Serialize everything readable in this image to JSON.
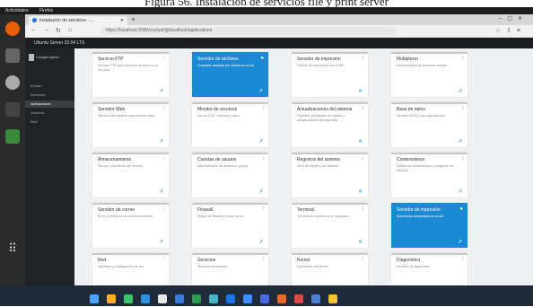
{
  "caption": "Figura 56. Instalación de servicios file y print server",
  "top_bar": {
    "activities": "Actividades",
    "app": "Firefox",
    "clock": "",
    "tray": ""
  },
  "browser": {
    "tab_title": "Instalación de servicios - ...",
    "url": "https://localhost:9090/cockpit/@localhost/applications",
    "url_right": ""
  },
  "cockpit": {
    "host": "Ubuntu Server 22.04 LTS",
    "user": ""
  },
  "sidebar": {
    "header": "Cockpit Admin",
    "items": [
      {
        "label": "Estado"
      },
      {
        "label": "Servicios"
      },
      {
        "label": "Aplicaciones"
      },
      {
        "label": "Archivos"
      },
      {
        "label": "Red"
      }
    ]
  },
  "cards": [
    {
      "title": "Servicio FTP",
      "desc": "Servidor FTP para compartir archivos en la red local",
      "mark": "i",
      "action": "↗",
      "selected": false
    },
    {
      "title": "Servidor de archivos",
      "desc": "Comparte carpetas con Samba en la red",
      "mark": "●",
      "action": "↗",
      "selected": true
    },
    {
      "title": "Servidor de impresión",
      "desc": "Gestión de impresoras con CUPS",
      "mark": "i",
      "action": "✕",
      "selected": false
    },
    {
      "title": "Multiplexor",
      "desc": "Administración de sesiones remotas",
      "mark": "i",
      "action": "↗",
      "selected": false
    },
    {
      "title": "Servidor Web",
      "desc": "Servidor web Apache para publicar sitios",
      "mark": "i",
      "action": "↗",
      "selected": false
    },
    {
      "title": "Monitor de recursos",
      "desc": "Uso de CPU, memoria y disco",
      "mark": "i",
      "action": "↗",
      "selected": false
    },
    {
      "title": "Actualizaciones del sistema",
      "desc": "Paquetes pendientes de instalar y actualizaciones de seguridad",
      "mark": "i",
      "action": "✕",
      "selected": false
    },
    {
      "title": "Base de datos",
      "desc": "Servidor MySQL para aplicaciones",
      "mark": "i",
      "action": "↗",
      "selected": false
    },
    {
      "title": "Almacenamiento",
      "desc": "Discos y volúmenes del servidor",
      "mark": "i",
      "action": "↗",
      "selected": false
    },
    {
      "title": "Cuentas de usuario",
      "desc": "Administración de usuarios y grupos",
      "mark": "i",
      "action": "↗",
      "selected": false
    },
    {
      "title": "Registros del sistema",
      "desc": "Visor de registros del sistema",
      "mark": "i",
      "action": "✕",
      "selected": false
    },
    {
      "title": "Contenedores",
      "desc": "Gestión de contenedores e imágenes del sistema",
      "mark": "i",
      "action": "↗",
      "selected": false
    },
    {
      "title": "Servidor de correo",
      "desc": "Envío y recepción de correo electrónico",
      "mark": "i",
      "action": "↗",
      "selected": false
    },
    {
      "title": "Firewall",
      "desc": "Reglas de firewall y zonas de red",
      "mark": "i",
      "action": "↗",
      "selected": false
    },
    {
      "title": "Terminal",
      "desc": "Terminal del servidor en el navegador",
      "mark": "i",
      "action": "✕",
      "selected": false
    },
    {
      "title": "Servidor de impresión",
      "desc": "Impresoras compartidas en la red",
      "mark": "●",
      "action": "↗",
      "selected": true
    },
    {
      "title": "Red",
      "desc": "Interfaces y configuración de red",
      "mark": "i",
      "action": "↗",
      "selected": false
    },
    {
      "title": "Servicios",
      "desc": "Servicios del sistema",
      "mark": "i",
      "action": "↗",
      "selected": false
    },
    {
      "title": "Kernel",
      "desc": "Información del kernel",
      "mark": "i",
      "action": "✕",
      "selected": false
    },
    {
      "title": "Diagnóstico",
      "desc": "Informes de diagnóstico",
      "mark": "i",
      "action": "↗",
      "selected": false
    }
  ],
  "taskbar": {
    "icon_colors": [
      "#4aa3ff",
      "#ffb020",
      "#3cc36b",
      "#2f8fe0",
      "#e8e8e8",
      "#3a7bd5",
      "#2e9b4f",
      "#46b6c8",
      "#1a73e8",
      "#3f8cff",
      "#4b6bdc",
      "#e26a2c",
      "#d94a4a",
      "#4f7fd0",
      "#f2c230"
    ],
    "tray": "",
    "time": "",
    "date": ""
  }
}
